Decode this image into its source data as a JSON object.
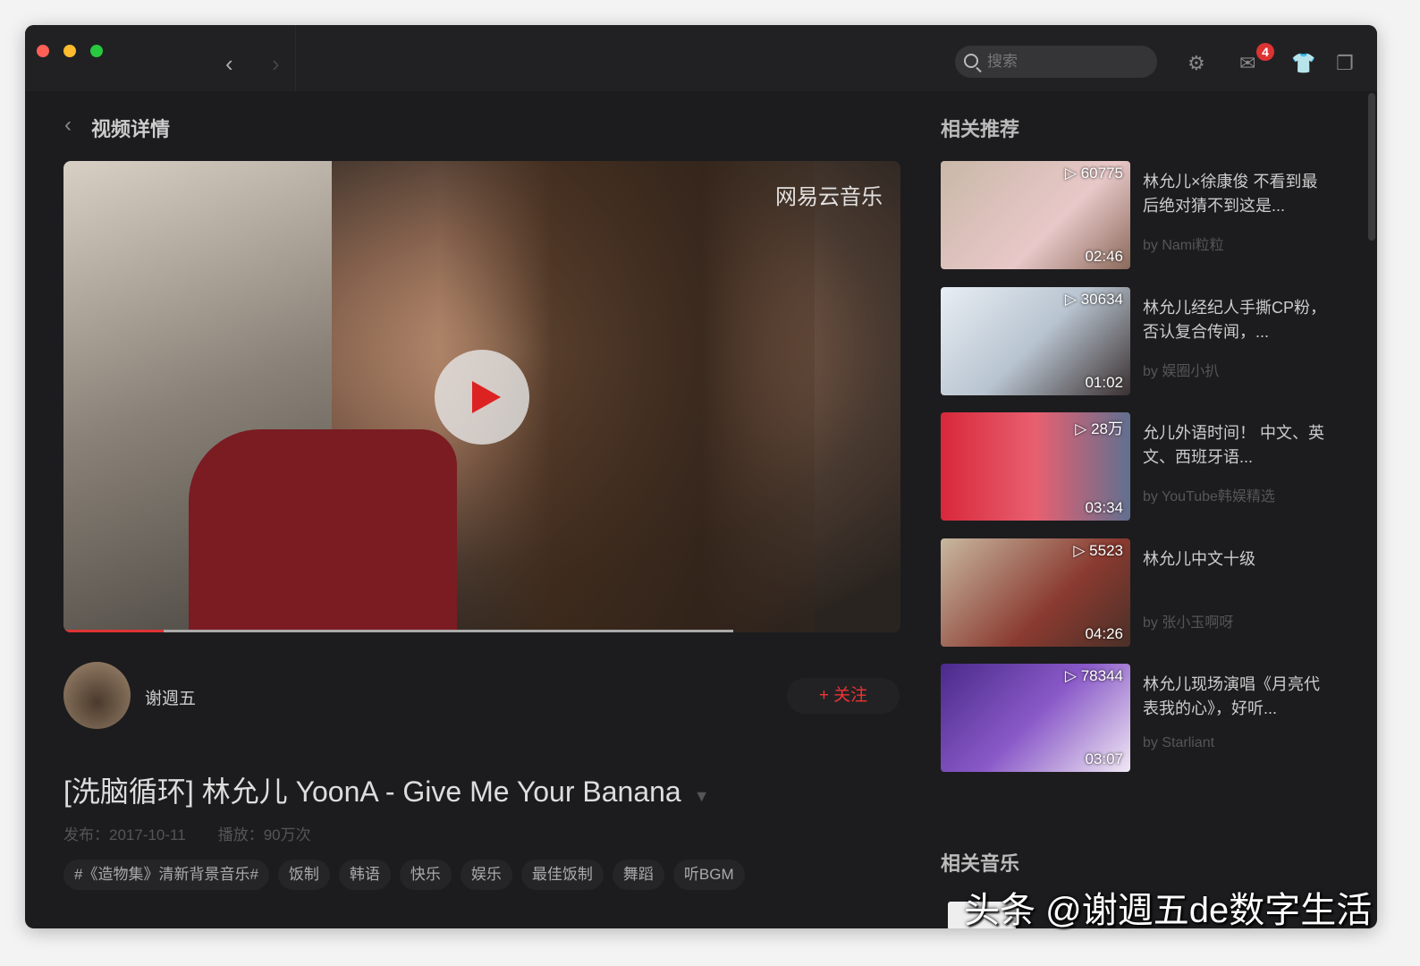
{
  "titlebar": {
    "search_placeholder": "搜索",
    "mail_badge": "4"
  },
  "page": {
    "title": "视频详情"
  },
  "video": {
    "watermark": "网易云音乐",
    "progress_percent": 12,
    "buffered_percent": 80
  },
  "author": {
    "name": "谢週五",
    "follow_label": "+ 关注"
  },
  "details": {
    "title": "[洗脑循环] 林允儿 YoonA - Give Me Your Banana",
    "publish": "发布：2017-10-11",
    "plays": "播放：90万次",
    "tags": [
      "#《造物集》清新背景音乐#",
      "饭制",
      "韩语",
      "快乐",
      "娱乐",
      "最佳饭制",
      "舞蹈",
      "听BGM"
    ]
  },
  "sidebar": {
    "related_title": "相关推荐",
    "music_title": "相关音乐",
    "items": [
      {
        "count": "60775",
        "duration": "02:46",
        "title": "林允儿×徐康俊 不看到最后绝对猜不到这是...",
        "by": "by Nami粒粒"
      },
      {
        "count": "30634",
        "duration": "01:02",
        "title": "林允儿经纪人手撕CP粉，否认复合传闻，...",
        "by": "by 娱圈小扒"
      },
      {
        "count": "28万",
        "duration": "03:34",
        "title": "允儿外语时间！ 中文、英文、西班牙语...",
        "by": "by YouTube韩娱精选"
      },
      {
        "count": "5523",
        "duration": "04:26",
        "title": "林允儿中文十级",
        "by": "by 张小玉啊呀"
      },
      {
        "count": "78344",
        "duration": "03:07",
        "title": "林允儿现场演唱《月亮代表我的心》，好听...",
        "by": "by Starliant"
      }
    ]
  },
  "watermark": "头条 @谢週五de数字生活"
}
